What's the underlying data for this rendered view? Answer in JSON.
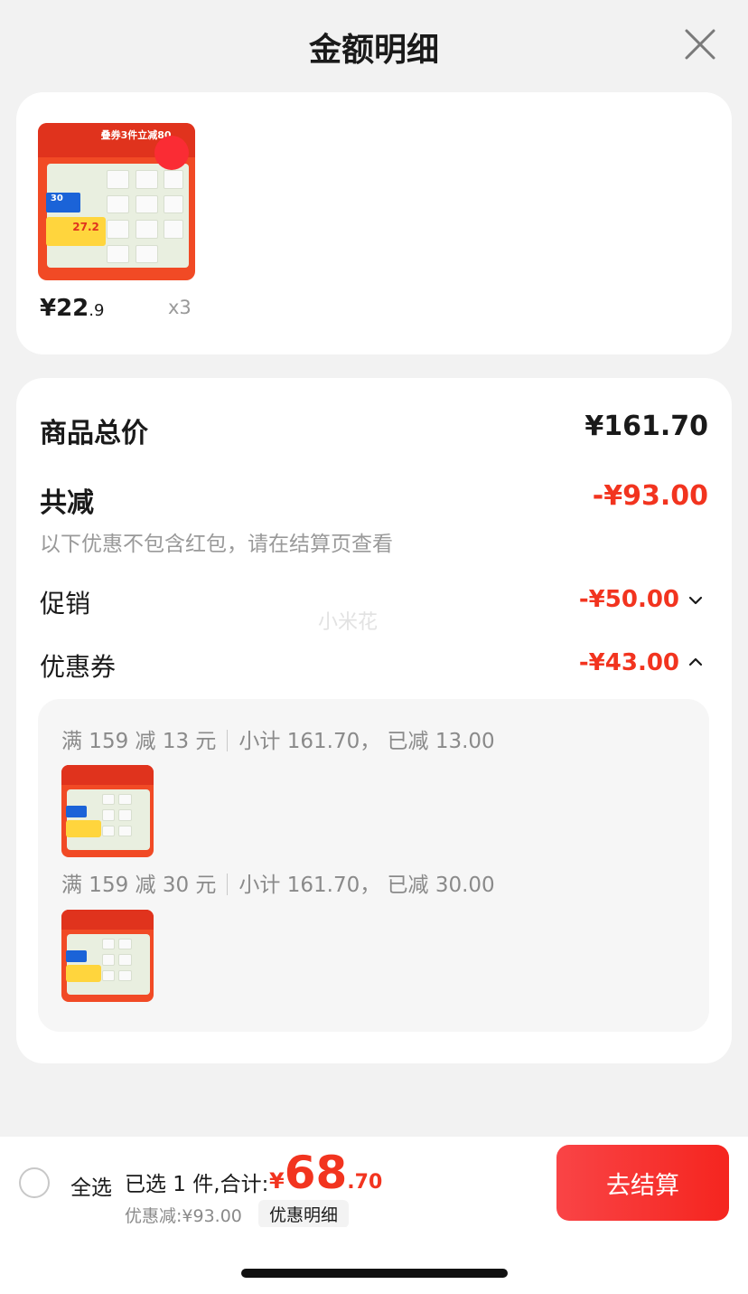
{
  "header": {
    "title": "金额明细",
    "close_icon": "close-icon"
  },
  "product": {
    "image_banner": "叠券3件立减80",
    "image_coupon_num": "30",
    "image_price_tag": "27.2",
    "price_integer": "¥22",
    "price_decimal": ".9",
    "quantity": "x3"
  },
  "breakdown": {
    "total_label": "商品总价",
    "total_value": "¥161.70",
    "reduction_label": "共减",
    "reduction_value": "-¥93.00",
    "reduction_note": "以下优惠不包含红包，请在结算页查看",
    "promotion_label": "促销",
    "promotion_value": "-¥50.00",
    "coupon_label": "优惠券",
    "coupon_value": "-¥43.00",
    "watermark": "小米花"
  },
  "coupons": [
    {
      "rule": "满 159 减 13 元",
      "detail": "小计 161.70，  已减 13.00"
    },
    {
      "rule": "满 159 减 30 元",
      "detail": "小计 161.70，  已减 30.00"
    }
  ],
  "footer": {
    "select_all": "全选",
    "summary_prefix": "已选 1 件,合计:",
    "total_symbol": "¥",
    "total_integer": "68",
    "total_decimal": ".70",
    "discount_text": "优惠减:¥93.00",
    "detail_button": "优惠明细",
    "checkout_button": "去结算"
  },
  "colors": {
    "accent_red": "#f2341f",
    "button_gradient_start": "#f94446",
    "button_gradient_end": "#f5251f"
  }
}
